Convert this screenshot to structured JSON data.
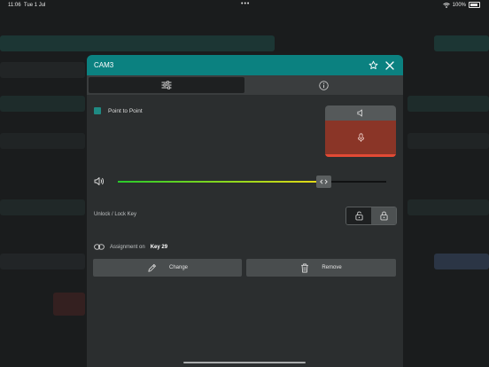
{
  "status_bar": {
    "time": "11:06",
    "date": "Tue 1 Jul",
    "battery": "100%"
  },
  "dialog": {
    "title": "CAM3",
    "accent_color": "#0b8180",
    "tabs": [
      {
        "icon": "sliders-icon",
        "active": true
      },
      {
        "icon": "info-icon",
        "active": false
      }
    ],
    "point_to_point": {
      "label": "Point to Point",
      "checked": true
    },
    "sound_panel": {
      "speaker_icon": "speaker-icon",
      "mic_icon": "microphone-icon",
      "mic_active_color": "#8a3527"
    },
    "volume": {
      "icon": "volume-icon",
      "level": 0.77
    },
    "lock": {
      "label": "Unlock / Lock Key",
      "selected": "unlock"
    },
    "assignment": {
      "prefix": "Assignment on",
      "key": "Key 29"
    },
    "buttons": {
      "change": "Change",
      "remove": "Remove"
    }
  }
}
